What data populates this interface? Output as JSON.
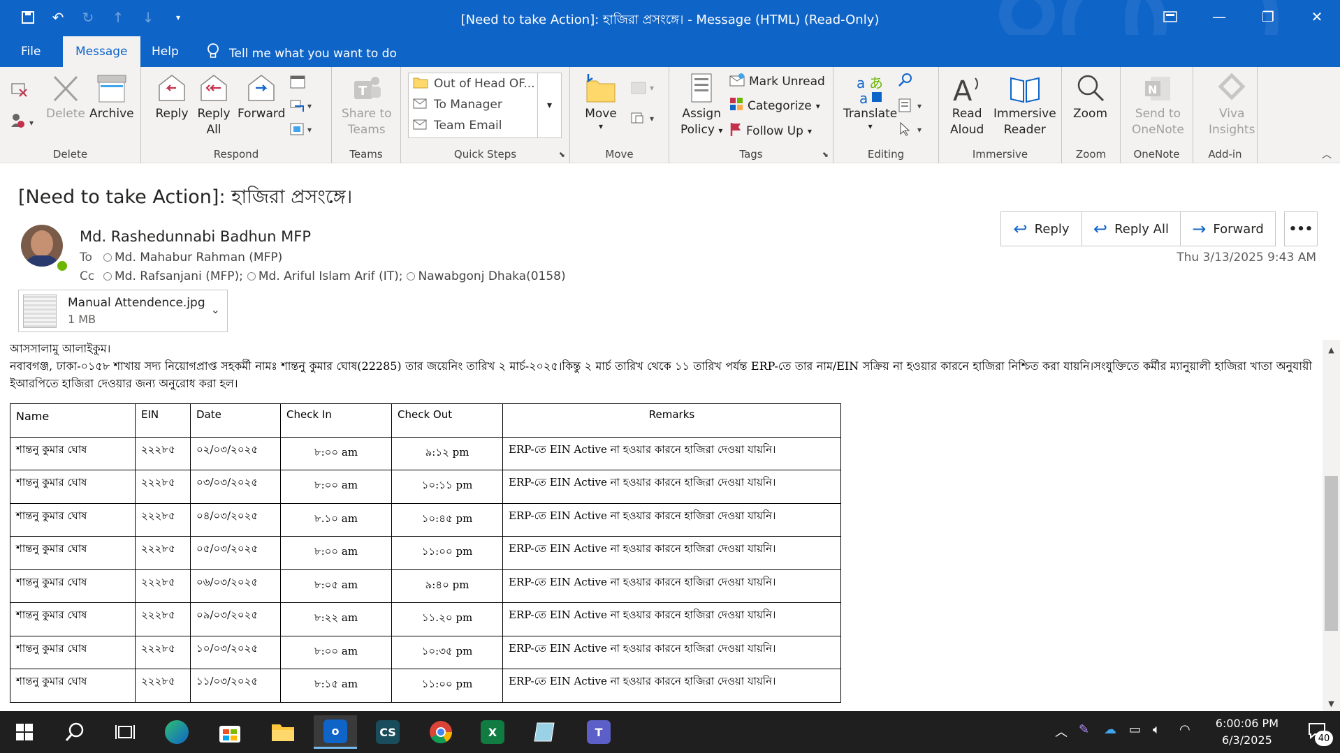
{
  "window": {
    "title": "[Need to take Action]: হাজিরা প্রসংঙ্গে।  -  Message (HTML) (Read-Only)",
    "qat": [
      "save-icon",
      "undo-icon",
      "redo-icon",
      "up-icon",
      "down-icon",
      "customize-icon"
    ]
  },
  "tabs": [
    {
      "label": "File"
    },
    {
      "label": "Message"
    },
    {
      "label": "Help"
    }
  ],
  "tellme": "Tell me what you want to do",
  "ribbon": {
    "delete_group": {
      "label": "Delete",
      "delete": "Delete",
      "archive": "Archive"
    },
    "respond_group": {
      "label": "Respond",
      "reply": "Reply",
      "reply_all_1": "Reply",
      "reply_all_2": "All",
      "forward": "Forward"
    },
    "teams_group": {
      "label": "Teams",
      "share_1": "Share to",
      "share_2": "Teams"
    },
    "quicksteps_group": {
      "label": "Quick Steps",
      "items": [
        "Out of Head OF...",
        "To Manager",
        "Team Email"
      ]
    },
    "move_group": {
      "label": "Move",
      "move": "Move"
    },
    "tags_group": {
      "label": "Tags",
      "assign_1": "Assign",
      "assign_2": "Policy",
      "mark_unread": "Mark Unread",
      "categorize": "Categorize",
      "follow_up": "Follow Up"
    },
    "editing_group": {
      "label": "Editing",
      "translate": "Translate"
    },
    "immersive_group": {
      "label": "Immersive",
      "read_1": "Read",
      "read_2": "Aloud",
      "reader_1": "Immersive",
      "reader_2": "Reader"
    },
    "zoom_group": {
      "label": "Zoom",
      "zoom": "Zoom"
    },
    "onenote_group": {
      "label": "OneNote",
      "send_1": "Send to",
      "send_2": "OneNote"
    },
    "addin_group": {
      "label": "Add-in",
      "viva_1": "Viva",
      "viva_2": "Insights"
    }
  },
  "message": {
    "subject": "[Need to take Action]: হাজিরা প্রসংঙ্গে।",
    "sender": "Md. Rashedunnabi Badhun MFP",
    "to_label": "To",
    "to": "Md. Mahabur Rahman (MFP)",
    "cc_label": "Cc",
    "cc": [
      "Md. Rafsanjani (MFP);",
      "Md. Ariful Islam Arif (IT);",
      "Nawabgonj Dhaka(0158)"
    ],
    "date": "Thu 3/13/2025 9:43 AM",
    "actions": {
      "reply": "Reply",
      "reply_all": "Reply All",
      "forward": "Forward",
      "more": "•••"
    },
    "attachment": {
      "name": "Manual Attendence.jpg",
      "size": "1 MB"
    }
  },
  "body": {
    "greeting": "আসসালামু আলাইকুম।",
    "paragraph": "নবাবগঞ্জ, ঢাকা-০১৫৮ শাখায় সদ্য নিয়োগপ্রাপ্ত সহকর্মী নামঃ শান্তনু কুমার ঘোষ(22285) তার জয়েনিং তারিখ ২ মার্চ-২০২৫।কিন্তু ২ মার্চ তারিখ থেকে ১১ তারিখ পর্যন্ত ERP-তে তার নাম/EIN সক্রিয় না হওয়ার কারনে হাজিরা নিশ্চিত করা যায়নি।সংযুক্তিতে কর্মীর ম্যানুয়ালী হাজিরা খাতা অনুযায়ী ইআরপিতে হাজিরা দেওয়ার জন্য অনুরোধ করা হল।",
    "table": {
      "headers": [
        "Name",
        "EIN",
        "Date",
        "Check In",
        "Check Out",
        "Remarks"
      ],
      "rows": [
        [
          "শান্তনু কুমার ঘোষ",
          "২২২৮৫",
          "০২/০৩/২০২৫",
          "৮:০০ am",
          "৯:১২ pm",
          "ERP-তে EIN Active না হওয়ার কারনে হাজিরা দেওয়া যায়নি।"
        ],
        [
          "শান্তনু কুমার ঘোষ",
          "২২২৮৫",
          "০৩/০৩/২০২৫",
          "৮:০০ am",
          "১০:১১ pm",
          "ERP-তে EIN Active না হওয়ার কারনে হাজিরা দেওয়া যায়নি।"
        ],
        [
          "শান্তনু কুমার ঘোষ",
          "২২২৮৫",
          "০৪/০৩/২০২৫",
          "৮.১০ am",
          "১০:৪৫ pm",
          "ERP-তে EIN Active না হওয়ার কারনে হাজিরা দেওয়া যায়নি।"
        ],
        [
          "শান্তনু কুমার ঘোষ",
          "২২২৮৫",
          "০৫/০৩/২০২৫",
          "৮:০০ am",
          "১১:০০ pm",
          "ERP-তে EIN Active না হওয়ার কারনে হাজিরা দেওয়া যায়নি।"
        ],
        [
          "শান্তনু কুমার ঘোষ",
          "২২২৮৫",
          "০৬/০৩/২০২৫",
          "৮:০৫ am",
          "৯:৪০ pm",
          "ERP-তে EIN Active না হওয়ার কারনে হাজিরা দেওয়া যায়নি।"
        ],
        [
          "শান্তনু কুমার ঘোষ",
          "২২২৮৫",
          "০৯/০৩/২০২৫",
          "৮:২২ am",
          "১১.২০ pm",
          "ERP-তে EIN Active না হওয়ার কারনে হাজিরা দেওয়া যায়নি।"
        ],
        [
          "শান্তনু কুমার ঘোষ",
          "২২২৮৫",
          "১০/০৩/২০২৫",
          "৮:০০ am",
          "১০:৩৫ pm",
          "ERP-তে EIN Active না হওয়ার কারনে হাজিরা দেওয়া যায়নি।"
        ],
        [
          "শান্তনু কুমার ঘোষ",
          "২২২৮৫",
          "১১/০৩/২০২৫",
          "৮:১৫ am",
          "১১:০০ pm",
          "ERP-তে EIN Active না হওয়ার কারনে হাজিরা দেওয়া যায়নি।"
        ]
      ]
    }
  },
  "taskbar": {
    "apps": [
      "start-icon",
      "search-icon",
      "task-view-icon",
      "edge-icon",
      "store-icon",
      "file-explorer-icon",
      "outlook-icon",
      "cs-icon",
      "chrome-icon",
      "excel-icon",
      "app-icon",
      "teams-icon"
    ],
    "cs_label": "CS",
    "time": "6:00:06 PM",
    "date": "6/3/2025",
    "notif_count": "40"
  },
  "colors": {
    "accent": "#0f64c8",
    "ribbon_bg": "#f3f2f1",
    "taskbar": "#1f1f1f"
  }
}
